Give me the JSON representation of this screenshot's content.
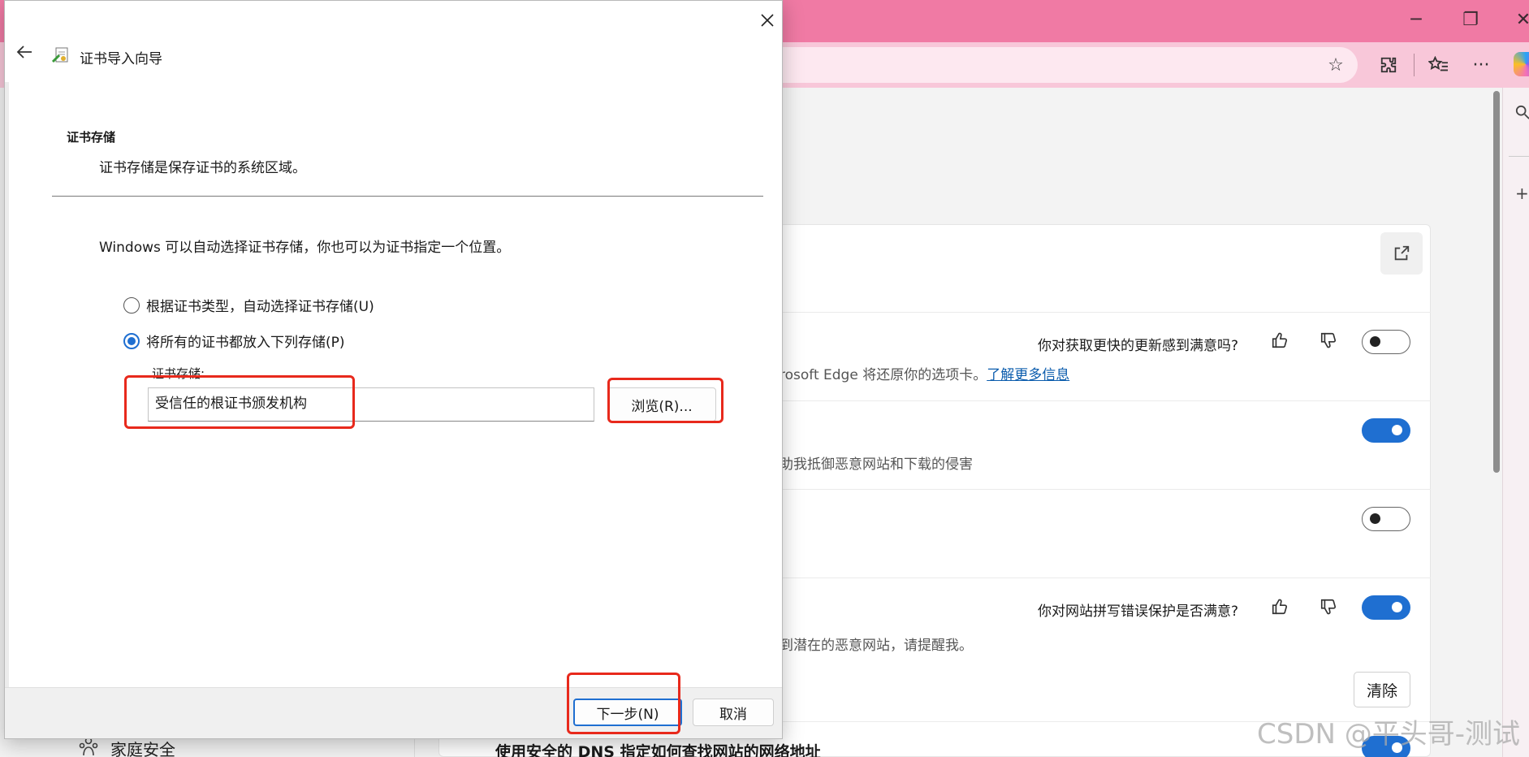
{
  "browser": {
    "window_controls": {
      "minimize": "─",
      "restore": "❐",
      "close": "✕"
    },
    "toolbar_icons": [
      "star-icon",
      "extensions-icon",
      "favorites-icon",
      "more-icon"
    ],
    "colors": {
      "titlebar": "#f07aa4",
      "toolbar": "#f8c7d9",
      "accent": "#1f6fd1"
    }
  },
  "settings": {
    "row1": {
      "feedback_question": "你对获取更快的更新感到满意吗?",
      "desc_prefix": "rosoft Edge 将还原你的选项卡。",
      "desc_link": "了解更多信息",
      "toggle_on": false
    },
    "row2": {
      "desc": "助我抵御恶意网站和下载的侵害",
      "toggle_on": true
    },
    "row3": {
      "toggle_on": false
    },
    "row4": {
      "feedback_question": "你对网站拼写错误保护是否满意?",
      "desc": "到潜在的恶意网站，请提醒我。",
      "toggle_on": true
    },
    "clear_button": "清除",
    "dns_label": "使用安全的 DNS 指定如何查找网站的网络地址",
    "sidebar_item": "家庭安全"
  },
  "watermark": "CSDN @平头哥-测试",
  "wizard": {
    "title": "证书导入向导",
    "section_title": "证书存储",
    "section_desc": "证书存储是保存证书的系统区域。",
    "intro": "Windows 可以自动选择证书存储，你也可以为证书指定一个位置。",
    "radio_auto": {
      "label": "根据证书类型，自动选择证书存储(U)",
      "checked": false
    },
    "radio_manual": {
      "label": "将所有的证书都放入下列存储(P)",
      "checked": true
    },
    "store_label": "证书存储:",
    "store_value": "受信任的根证书颁发机构",
    "browse_button": "浏览(R)...",
    "next_button": "下一步(N)",
    "cancel_button": "取消"
  }
}
